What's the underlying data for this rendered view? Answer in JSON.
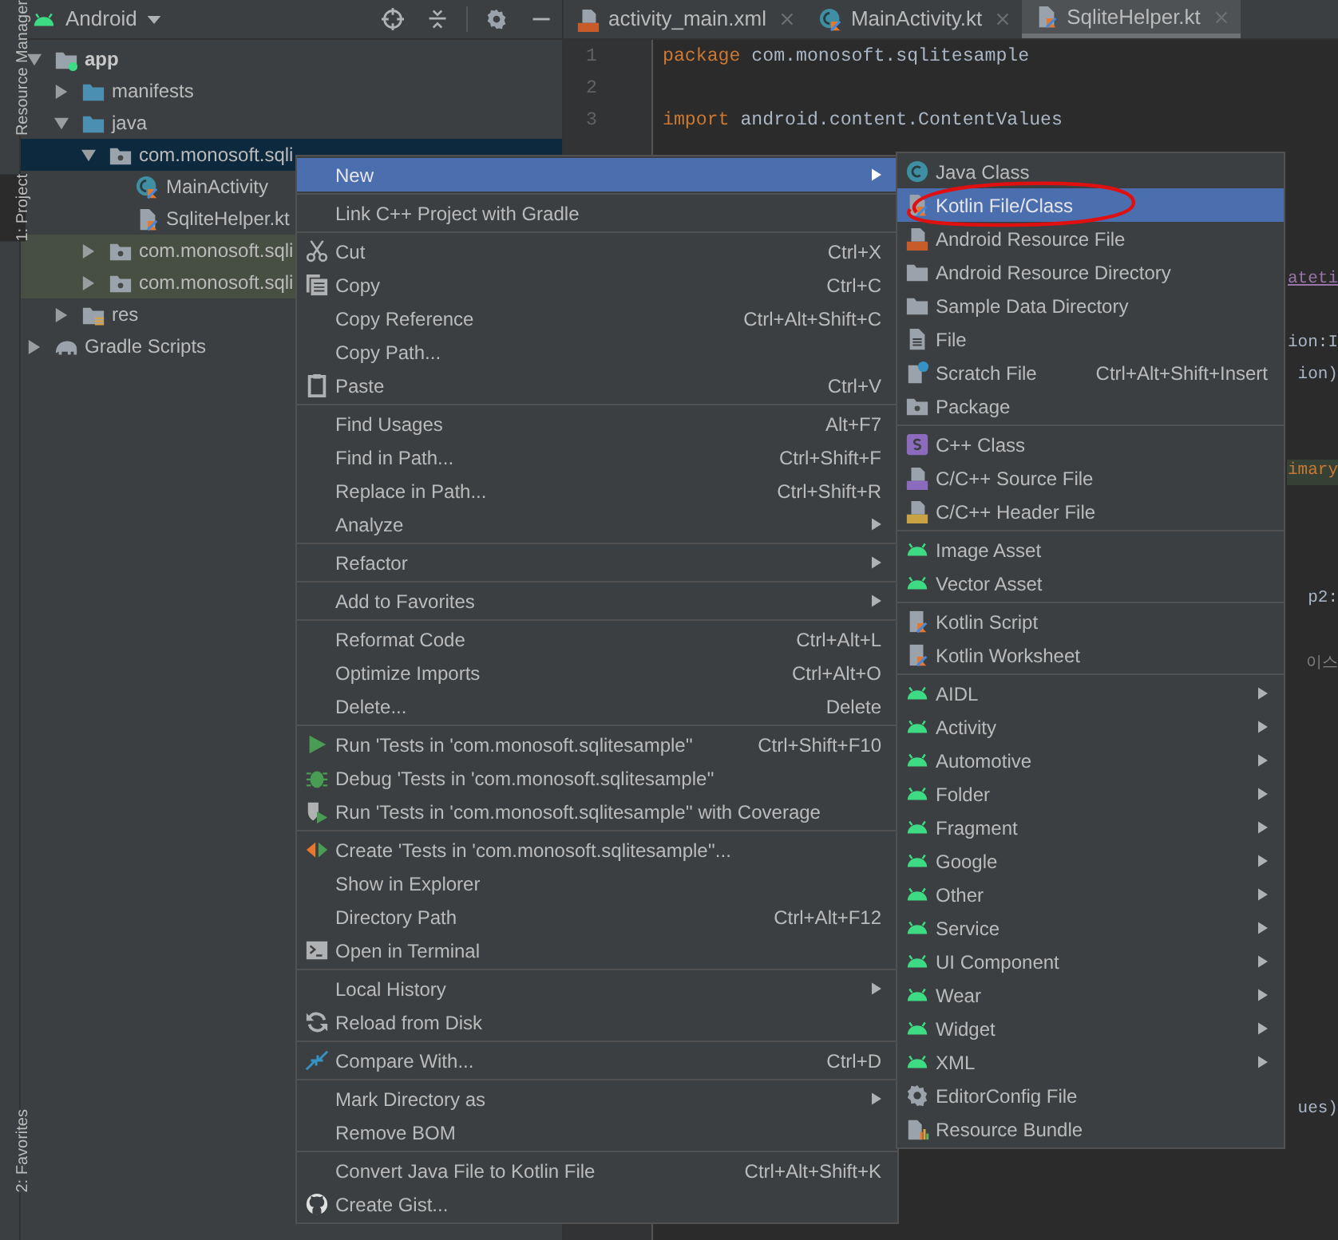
{
  "tool_strip": [
    {
      "label": "Resource Manager",
      "selected": false
    },
    {
      "label": "1: Project",
      "selected": true
    },
    {
      "label": "2: Favorites",
      "selected": false
    }
  ],
  "project_panel": {
    "view": "Android",
    "tree": [
      {
        "label": "app",
        "kind": "module",
        "expanded": true,
        "selected": false,
        "children": [
          {
            "label": "manifests",
            "kind": "folder",
            "expanded": false,
            "selected": false
          },
          {
            "label": "java",
            "kind": "folder",
            "expanded": true,
            "selected": false,
            "children": [
              {
                "label": "com.monosoft.sqli",
                "kind": "package",
                "expanded": true,
                "selected": true,
                "children": [
                  {
                    "label": "MainActivity",
                    "kind": "class",
                    "selected": false
                  },
                  {
                    "label": "SqliteHelper.kt",
                    "kind": "kfile",
                    "selected": false
                  }
                ]
              },
              {
                "label": "com.monosoft.sqli",
                "kind": "test_package",
                "expanded": false,
                "selected": false
              },
              {
                "label": "com.monosoft.sqli",
                "kind": "test_package",
                "expanded": false,
                "selected": false
              }
            ]
          },
          {
            "label": "res",
            "kind": "res",
            "expanded": false,
            "selected": false
          }
        ]
      },
      {
        "label": "Gradle Scripts",
        "kind": "gradle",
        "expanded": false,
        "selected": false
      }
    ]
  },
  "editor": {
    "tabs": [
      {
        "label": "activity_main.xml",
        "kind": "xml",
        "selected": false
      },
      {
        "label": "MainActivity.kt",
        "kind": "class",
        "selected": false
      },
      {
        "label": "SqliteHelper.kt",
        "kind": "kfile",
        "selected": true
      }
    ],
    "lines": [
      {
        "number": "1",
        "keyword": "package",
        "code": "com.monosoft.sqlitesample"
      },
      {
        "number": "2"
      },
      {
        "number": "3",
        "keyword": "import",
        "code": "android.content.ContentValues"
      }
    ],
    "fragments": [
      {
        "text": "ateti",
        "kind": "link"
      },
      {
        "text": "ion:I",
        "kind": "plain"
      },
      {
        "text": "ion)",
        "kind": "plain"
      },
      {
        "text": "imary",
        "kind": "highlight"
      },
      {
        "text": "p2:",
        "kind": "plain"
      },
      {
        "text": "이스",
        "kind": "comment"
      },
      {
        "text": "ues)",
        "kind": "plain"
      }
    ]
  },
  "context_menu": {
    "groups": [
      [
        {
          "label": "New",
          "submenu": true,
          "selected": true
        }
      ],
      [
        {
          "label": "Link C++ Project with Gradle",
          "selected": false
        }
      ],
      [
        {
          "label": "Cut",
          "kind": "scissors",
          "shortcut": "Ctrl+X",
          "selected": false
        },
        {
          "label": "Copy",
          "kind": "copy",
          "shortcut": "Ctrl+C",
          "selected": false
        },
        {
          "label": "Copy Reference",
          "shortcut": "Ctrl+Alt+Shift+C",
          "selected": false
        },
        {
          "label": "Copy Path...",
          "selected": false
        },
        {
          "label": "Paste",
          "kind": "paste",
          "shortcut": "Ctrl+V",
          "selected": false
        }
      ],
      [
        {
          "label": "Find Usages",
          "shortcut": "Alt+F7",
          "selected": false
        },
        {
          "label": "Find in Path...",
          "shortcut": "Ctrl+Shift+F",
          "selected": false
        },
        {
          "label": "Replace in Path...",
          "shortcut": "Ctrl+Shift+R",
          "selected": false
        },
        {
          "label": "Analyze",
          "submenu": true,
          "selected": false
        }
      ],
      [
        {
          "label": "Refactor",
          "submenu": true,
          "selected": false
        }
      ],
      [
        {
          "label": "Add to Favorites",
          "submenu": true,
          "selected": false
        }
      ],
      [
        {
          "label": "Reformat Code",
          "shortcut": "Ctrl+Alt+L",
          "selected": false
        },
        {
          "label": "Optimize Imports",
          "shortcut": "Ctrl+Alt+O",
          "selected": false
        },
        {
          "label": "Delete...",
          "shortcut": "Delete",
          "selected": false
        }
      ],
      [
        {
          "label": "Run 'Tests in 'com.monosoft.sqlitesample''",
          "kind": "run",
          "shortcut": "Ctrl+Shift+F10",
          "selected": false
        },
        {
          "label": "Debug 'Tests in 'com.monosoft.sqlitesample''",
          "kind": "debug",
          "selected": false
        },
        {
          "label": "Run 'Tests in 'com.monosoft.sqlitesample'' with Coverage",
          "kind": "coverage",
          "selected": false
        }
      ],
      [
        {
          "label": "Create 'Tests in 'com.monosoft.sqlitesample''...",
          "kind": "create",
          "selected": false
        },
        {
          "label": "Show in Explorer",
          "selected": false
        },
        {
          "label": "Directory Path",
          "shortcut": "Ctrl+Alt+F12",
          "selected": false
        },
        {
          "label": "Open in Terminal",
          "kind": "terminal",
          "selected": false
        }
      ],
      [
        {
          "label": "Local History",
          "submenu": true,
          "selected": false
        },
        {
          "label": "Reload from Disk",
          "kind": "reload",
          "selected": false
        }
      ],
      [
        {
          "label": "Compare With...",
          "kind": "compare",
          "shortcut": "Ctrl+D",
          "selected": false
        }
      ],
      [
        {
          "label": "Mark Directory as",
          "submenu": true,
          "selected": false
        },
        {
          "label": "Remove BOM",
          "selected": false
        }
      ],
      [
        {
          "label": "Convert Java File to Kotlin File",
          "shortcut": "Ctrl+Alt+Shift+K",
          "selected": false
        },
        {
          "label": "Create Gist...",
          "kind": "github",
          "selected": false
        }
      ]
    ]
  },
  "submenu": {
    "groups": [
      [
        {
          "label": "Java Class",
          "kind": "java",
          "selected": false
        },
        {
          "label": "Kotlin File/Class",
          "kind": "kfile",
          "selected": true
        },
        {
          "label": "Android Resource File",
          "kind": "xml",
          "selected": false
        },
        {
          "label": "Android Resource Directory",
          "kind": "greyfolder",
          "selected": false
        },
        {
          "label": "Sample Data Directory",
          "kind": "greyfolder",
          "selected": false
        },
        {
          "label": "File",
          "kind": "doc",
          "selected": false
        },
        {
          "label": "Scratch File",
          "kind": "scratch",
          "shortcut": "Ctrl+Alt+Shift+Insert",
          "selected": false
        },
        {
          "label": "Package",
          "kind": "package",
          "selected": false
        }
      ],
      [
        {
          "label": "C++ Class",
          "kind": "cppclass",
          "selected": false
        },
        {
          "label": "C/C++ Source File",
          "kind": "cppsrc",
          "selected": false
        },
        {
          "label": "C/C++ Header File",
          "kind": "chdr",
          "selected": false
        }
      ],
      [
        {
          "label": "Image Asset",
          "kind": "android",
          "selected": false
        },
        {
          "label": "Vector Asset",
          "kind": "android",
          "selected": false
        }
      ],
      [
        {
          "label": "Kotlin Script",
          "kind": "kscript",
          "selected": false
        },
        {
          "label": "Kotlin Worksheet",
          "kind": "kscript",
          "selected": false
        }
      ],
      [
        {
          "label": "AIDL",
          "kind": "android",
          "submenu": true,
          "selected": false
        },
        {
          "label": "Activity",
          "kind": "android",
          "submenu": true,
          "selected": false
        },
        {
          "label": "Automotive",
          "kind": "android",
          "submenu": true,
          "selected": false
        },
        {
          "label": "Folder",
          "kind": "android",
          "submenu": true,
          "selected": false
        },
        {
          "label": "Fragment",
          "kind": "android",
          "submenu": true,
          "selected": false
        },
        {
          "label": "Google",
          "kind": "android",
          "submenu": true,
          "selected": false
        },
        {
          "label": "Other",
          "kind": "android",
          "submenu": true,
          "selected": false
        },
        {
          "label": "Service",
          "kind": "android",
          "submenu": true,
          "selected": false
        },
        {
          "label": "UI Component",
          "kind": "android",
          "submenu": true,
          "selected": false
        },
        {
          "label": "Wear",
          "kind": "android",
          "submenu": true,
          "selected": false
        },
        {
          "label": "Widget",
          "kind": "android",
          "submenu": true,
          "selected": false
        },
        {
          "label": "XML",
          "kind": "android",
          "submenu": true,
          "selected": false
        },
        {
          "label": "EditorConfig File",
          "kind": "gear",
          "selected": false
        },
        {
          "label": "Resource Bundle",
          "kind": "bundle",
          "selected": false
        }
      ]
    ]
  }
}
